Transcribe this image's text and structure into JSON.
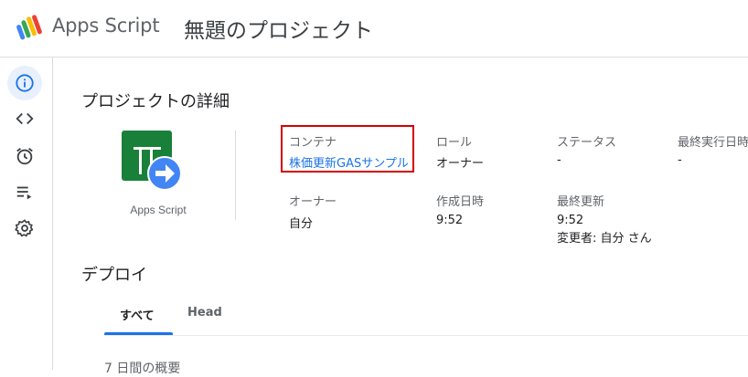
{
  "header": {
    "app_name": "Apps Script",
    "project_title": "無題のプロジェクト"
  },
  "sidebar": {
    "items": [
      {
        "name": "overview",
        "icon": "info-icon",
        "active": true
      },
      {
        "name": "editor",
        "icon": "code-icon",
        "active": false
      },
      {
        "name": "triggers",
        "icon": "alarm-clock-icon",
        "active": false
      },
      {
        "name": "executions",
        "icon": "executions-list-icon",
        "active": false
      },
      {
        "name": "settings",
        "icon": "gear-icon",
        "active": false
      }
    ]
  },
  "details": {
    "title": "プロジェクトの詳細",
    "icon_label": "Apps Script",
    "container": {
      "label": "コンテナ",
      "value": "株価更新GASサンプル"
    },
    "role": {
      "label": "ロール",
      "value": "オーナー"
    },
    "status": {
      "label": "ステータス",
      "value": "-"
    },
    "last_run": {
      "label": "最終実行日時",
      "value": "-"
    },
    "owner": {
      "label": "オーナー",
      "value": "自分"
    },
    "created": {
      "label": "作成日時",
      "value": "9:52"
    },
    "last_updated": {
      "label": "最終更新",
      "value": "9:52",
      "changed_by": "変更者: 自分 さん"
    }
  },
  "deploy": {
    "title": "デプロイ",
    "tabs": [
      {
        "label": "すべて",
        "active": true
      },
      {
        "label": "Head",
        "active": false
      }
    ],
    "summary_heading": "7 日間の概要"
  },
  "colors": {
    "accent": "#1a73e8",
    "highlight_box": "#d40000",
    "sheets_green": "#188038",
    "arrow_blue": "#4285f4"
  }
}
